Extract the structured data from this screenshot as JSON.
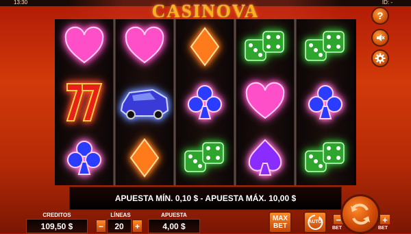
{
  "status": {
    "time": "13:30",
    "id_label": "ID: -"
  },
  "logo": "CASINOVA",
  "side_icons": {
    "help": "question-icon",
    "sound": "speaker-mute-icon",
    "settings": "gear-icon"
  },
  "reels": [
    [
      "heart",
      "seven",
      "club"
    ],
    [
      "heart",
      "car",
      "diamond"
    ],
    [
      "diamond",
      "club",
      "dice"
    ],
    [
      "dice",
      "heart",
      "spade"
    ],
    [
      "dice",
      "club",
      "dice"
    ]
  ],
  "info_message": "APUESTA MÍN. 0,10 $ - APUESTA MÁX. 10,00 $",
  "credits": {
    "label": "CREDITOS",
    "value": "109,50 $"
  },
  "lines": {
    "label": "LÍNEAS",
    "value": "20",
    "minus": "−",
    "plus": "+"
  },
  "bet": {
    "label": "APUESTA",
    "value": "4,00 $"
  },
  "max_bet": {
    "line1": "MAX",
    "line2": "BET"
  },
  "auto": {
    "label": "AUTO"
  },
  "bet_minus": {
    "symbol": "−",
    "label": "BET"
  },
  "bet_plus": {
    "symbol": "+",
    "label": "BET"
  },
  "colors": {
    "heart": "#ff4fc8",
    "diamond": "#ff7a1a",
    "club": "#2a3cff",
    "spade": "#8a2cff",
    "dice": "#2ea62e",
    "seven": "#e8201a",
    "car": "#3a3ad8"
  }
}
